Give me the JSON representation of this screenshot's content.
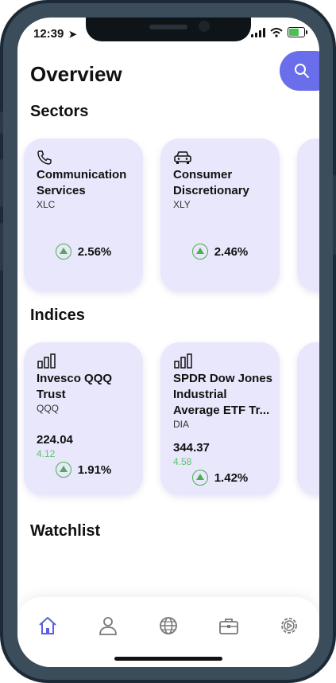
{
  "status_bar": {
    "time": "12:39"
  },
  "header": {
    "title": "Overview"
  },
  "sectors": {
    "title": "Sectors",
    "cards": [
      {
        "name": "Communication Services",
        "ticker": "XLC",
        "change_percent": "2.56%",
        "icon": "phone-icon"
      },
      {
        "name": "Consumer Discretionary",
        "ticker": "XLY",
        "change_percent": "2.46%",
        "icon": "car-icon"
      }
    ]
  },
  "indices": {
    "title": "Indices",
    "cards": [
      {
        "name": "Invesco QQQ Trust",
        "ticker": "QQQ",
        "price": "224.04",
        "change": "4.12",
        "change_percent": "1.91%",
        "icon": "bar-chart-icon"
      },
      {
        "name": "SPDR Dow Jones Industrial Average ETF Tr...",
        "ticker": "DIA",
        "price": "344.37",
        "change": "4.58",
        "change_percent": "1.42%",
        "icon": "bar-chart-icon"
      }
    ]
  },
  "watchlist": {
    "title": "Watchlist"
  },
  "tab_bar": {
    "items": [
      {
        "icon": "home-icon",
        "active": true
      },
      {
        "icon": "user-icon",
        "active": false
      },
      {
        "icon": "globe-icon",
        "active": false
      },
      {
        "icon": "briefcase-icon",
        "active": false
      },
      {
        "icon": "settings-icon",
        "active": false
      }
    ]
  },
  "colors": {
    "accent": "#6a6eea",
    "card_bg": "#e9e7fb",
    "positive": "#4caf50"
  }
}
